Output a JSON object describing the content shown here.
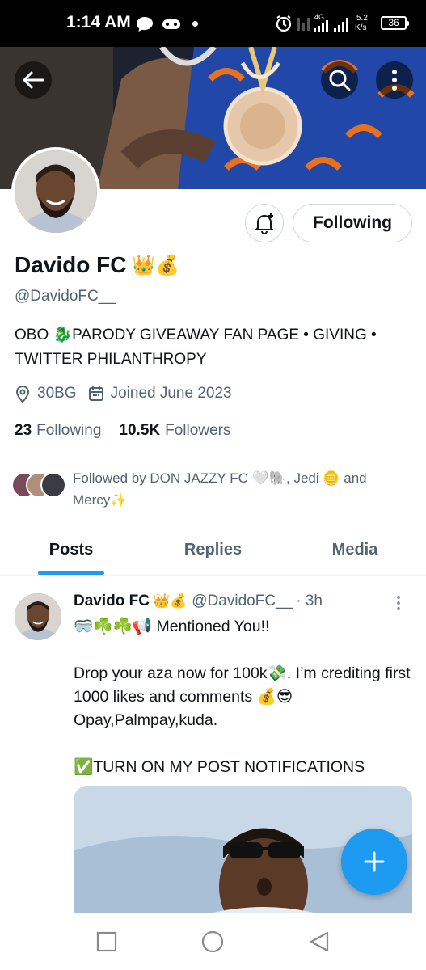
{
  "status_bar": {
    "time": "1:14 AM",
    "network_type": "4G",
    "speed_value": "5.2",
    "speed_unit": "K/s",
    "battery": "36"
  },
  "profile": {
    "display_name": "Davido FC",
    "name_emojis": "👑💰",
    "handle": "@DavidoFC__",
    "bio": "OBO 🐉PARODY GIVEAWAY FAN PAGE • GIVING • TWITTER PHILANTHROPY",
    "location": "30BG",
    "joined": "Joined June 2023",
    "following_count": "23",
    "following_label": "Following",
    "followers_count": "10.5K",
    "followers_label": "Followers",
    "followed_by": "Followed by DON JAZZY FC 🤍🐘, Jedi 🪙 and Mercy✨",
    "following_button": "Following"
  },
  "tabs": [
    {
      "label": "Posts",
      "active": true
    },
    {
      "label": "Replies",
      "active": false
    },
    {
      "label": "Media",
      "active": false
    }
  ],
  "post": {
    "author": "Davido FC",
    "author_emojis": "👑💰",
    "handle": "@DavidoFC__",
    "time": "· 3h",
    "line1": "🥽☘️☘️📢 Mentioned You!!",
    "line2": "Drop your aza now for 100k💸. I’m crediting first 1000 likes and comments 💰😎Opay,Palmpay,kuda.",
    "line3": "✅TURN ON MY POST NOTIFICATIONS"
  },
  "colors": {
    "accent": "#1d9bf0",
    "text_primary": "#0f1419",
    "text_secondary": "#536471"
  },
  "icons": {
    "back": "arrow-left",
    "search": "search",
    "more": "more-vertical",
    "notify": "bell-plus",
    "location": "location-pin",
    "calendar": "calendar",
    "compose": "plus"
  }
}
